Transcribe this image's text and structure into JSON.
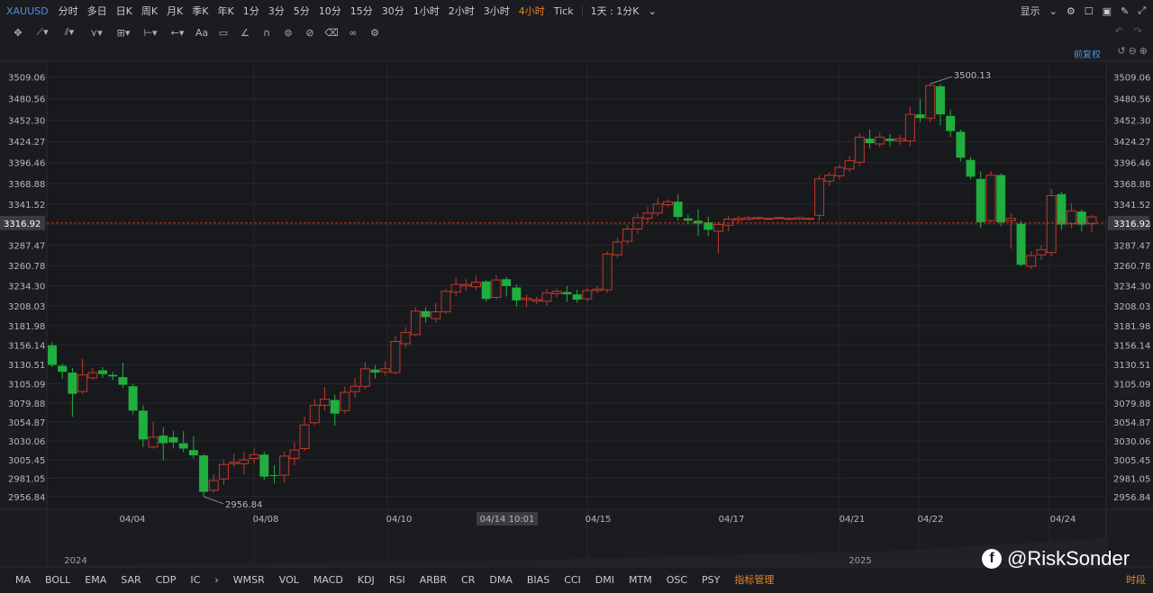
{
  "symbol": "XAUUSD",
  "timeframes": [
    "分时",
    "多日",
    "日K",
    "周K",
    "月K",
    "季K",
    "年K",
    "1分",
    "3分",
    "5分",
    "10分",
    "15分",
    "30分",
    "1小时",
    "2小时",
    "3小时",
    "4小时",
    "Tick"
  ],
  "active_timeframe": "4小时",
  "timeframe_selector": "1天 : 1分K",
  "display_label": "显示",
  "adjust_label": "前复权",
  "toolbar_icons": [
    "crosshair-icon",
    "trendline-icon",
    "fib-icon",
    "pattern-icon",
    "measure-icon",
    "ruler-icon",
    "arrow-icon",
    "text-icon",
    "note-icon",
    "brush-icon",
    "magnet-icon",
    "lock-icon",
    "hide-icon",
    "trash-icon",
    "link-icon",
    "settings-icon"
  ],
  "toolbar_text_label": "Aa",
  "indicators": [
    "MA",
    "BOLL",
    "EMA",
    "SAR",
    "CDP",
    "IC"
  ],
  "indicators2": [
    "WMSR",
    "VOL",
    "MACD",
    "KDJ",
    "RSI",
    "ARBR",
    "CR",
    "DMA",
    "BIAS",
    "CCI",
    "DMI",
    "MTM",
    "OSC",
    "PSY"
  ],
  "indicator_manage": "指标管理",
  "segment_label": "时段",
  "watermark": "@RiskSonder",
  "colors": {
    "background": "#1b1c1f",
    "up": "#c0392b",
    "down": "#1fae3f",
    "grid": "#26282c",
    "accent": "#e8832a",
    "link": "#4f8fe8"
  },
  "chart_data": {
    "type": "candlestick",
    "y_ticks": [
      3509.06,
      3480.56,
      3452.3,
      3424.27,
      3396.46,
      3368.88,
      3341.52,
      3314.6,
      3287.47,
      3260.78,
      3234.3,
      3208.03,
      3181.98,
      3156.14,
      3130.51,
      3105.09,
      3079.88,
      3054.87,
      3030.06,
      3005.45,
      2981.05,
      2956.84
    ],
    "ylim": [
      2940,
      3530
    ],
    "x_labels": [
      "04/04",
      "04/08",
      "04/10",
      "04/14 10:01",
      "04/15",
      "04/17",
      "04/21",
      "04/22",
      "04/24"
    ],
    "year_labels": [
      "2024",
      "2025"
    ],
    "current_price": "3316.92",
    "current_price_value": 3316.92,
    "high_label": "3500.13",
    "high_value": 3500.13,
    "low_label": "2956.84",
    "low_value": 2956.84,
    "candles": [
      [
        3156,
        3130,
        3160,
        3127
      ],
      [
        3129,
        3121,
        3132,
        3112
      ],
      [
        3120,
        3092,
        3126,
        3062
      ],
      [
        3095,
        3117,
        3138,
        3092
      ],
      [
        3113,
        3120,
        3126,
        3111
      ],
      [
        3123,
        3118,
        3127,
        3113
      ],
      [
        3117,
        3115,
        3121,
        3110
      ],
      [
        3114,
        3104,
        3133,
        3100
      ],
      [
        3102,
        3070,
        3105,
        3065
      ],
      [
        3070,
        3032,
        3077,
        3022
      ],
      [
        3022,
        3035,
        3055,
        3020
      ],
      [
        3037,
        3027,
        3048,
        3004
      ],
      [
        3035,
        3028,
        3043,
        3020
      ],
      [
        3027,
        3020,
        3043,
        3015
      ],
      [
        3018,
        3011,
        3036,
        3007
      ],
      [
        3011,
        2963,
        3013,
        2957
      ],
      [
        2965,
        2978,
        2986,
        2962
      ],
      [
        2980,
        2999,
        3005,
        2972
      ],
      [
        3000,
        3002,
        3013,
        2996
      ],
      [
        3000,
        3005,
        3016,
        2986
      ],
      [
        3007,
        3012,
        3020,
        3000
      ],
      [
        3012,
        2983,
        3016,
        2979
      ],
      [
        2985,
        2984,
        2998,
        2974
      ],
      [
        2985,
        3010,
        3016,
        2975
      ],
      [
        3007,
        3018,
        3028,
        2998
      ],
      [
        3020,
        3051,
        3062,
        3017
      ],
      [
        3054,
        3077,
        3085,
        3051
      ],
      [
        3077,
        3085,
        3101,
        3070
      ],
      [
        3084,
        3066,
        3091,
        3050
      ],
      [
        3070,
        3094,
        3102,
        3066
      ],
      [
        3095,
        3102,
        3113,
        3087
      ],
      [
        3102,
        3125,
        3134,
        3098
      ],
      [
        3124,
        3120,
        3130,
        3112
      ],
      [
        3121,
        3125,
        3135,
        3116
      ],
      [
        3120,
        3161,
        3168,
        3118
      ],
      [
        3158,
        3173,
        3180,
        3153
      ],
      [
        3170,
        3201,
        3206,
        3168
      ],
      [
        3201,
        3193,
        3206,
        3186
      ],
      [
        3191,
        3200,
        3212,
        3186
      ],
      [
        3200,
        3227,
        3230,
        3197
      ],
      [
        3226,
        3236,
        3245,
        3221
      ],
      [
        3234,
        3236,
        3243,
        3228
      ],
      [
        3233,
        3239,
        3248,
        3229
      ],
      [
        3240,
        3217,
        3242,
        3213
      ],
      [
        3219,
        3242,
        3248,
        3216
      ],
      [
        3243,
        3234,
        3246,
        3220
      ],
      [
        3232,
        3215,
        3236,
        3207
      ],
      [
        3216,
        3218,
        3223,
        3206
      ],
      [
        3214,
        3216,
        3220,
        3210
      ],
      [
        3214,
        3225,
        3230,
        3208
      ],
      [
        3224,
        3227,
        3231,
        3219
      ],
      [
        3226,
        3223,
        3234,
        3213
      ],
      [
        3223,
        3216,
        3229,
        3212
      ],
      [
        3217,
        3228,
        3231,
        3213
      ],
      [
        3228,
        3230,
        3234,
        3225
      ],
      [
        3229,
        3276,
        3280,
        3225
      ],
      [
        3275,
        3292,
        3297,
        3271
      ],
      [
        3293,
        3309,
        3314,
        3289
      ],
      [
        3309,
        3324,
        3330,
        3303
      ],
      [
        3323,
        3330,
        3338,
        3318
      ],
      [
        3330,
        3342,
        3350,
        3326
      ],
      [
        3341,
        3345,
        3348,
        3338
      ],
      [
        3345,
        3325,
        3355,
        3320
      ],
      [
        3323,
        3320,
        3328,
        3315
      ],
      [
        3320,
        3316,
        3335,
        3300
      ],
      [
        3318,
        3308,
        3325,
        3300
      ],
      [
        3306,
        3315,
        3318,
        3277
      ],
      [
        3314,
        3322,
        3326,
        3306
      ],
      [
        3321,
        3323,
        3327,
        3317
      ],
      [
        3322,
        3324,
        3326,
        3320
      ],
      [
        3323,
        3324,
        3325,
        3321
      ],
      [
        3323,
        3323,
        3324,
        3322
      ],
      [
        3323,
        3324,
        3325,
        3322
      ],
      [
        3323,
        3323,
        3324,
        3322
      ],
      [
        3322,
        3324,
        3325,
        3321
      ],
      [
        3323,
        3323,
        3324,
        3322
      ],
      [
        3327,
        3375,
        3380,
        3320
      ],
      [
        3372,
        3380,
        3384,
        3366
      ],
      [
        3379,
        3390,
        3394,
        3374
      ],
      [
        3388,
        3399,
        3405,
        3384
      ],
      [
        3397,
        3430,
        3435,
        3392
      ],
      [
        3428,
        3422,
        3440,
        3415
      ],
      [
        3421,
        3430,
        3436,
        3417
      ],
      [
        3428,
        3425,
        3434,
        3418
      ],
      [
        3425,
        3428,
        3433,
        3420
      ],
      [
        3425,
        3460,
        3470,
        3418
      ],
      [
        3460,
        3455,
        3480,
        3450
      ],
      [
        3455,
        3498,
        3500,
        3450
      ],
      [
        3497,
        3460,
        3500,
        3445
      ],
      [
        3458,
        3438,
        3466,
        3430
      ],
      [
        3437,
        3403,
        3440,
        3398
      ],
      [
        3400,
        3378,
        3404,
        3375
      ],
      [
        3375,
        3318,
        3385,
        3310
      ],
      [
        3320,
        3380,
        3385,
        3318
      ],
      [
        3380,
        3318,
        3382,
        3313
      ],
      [
        3320,
        3323,
        3330,
        3283
      ],
      [
        3316,
        3262,
        3320,
        3260
      ],
      [
        3260,
        3274,
        3280,
        3256
      ],
      [
        3275,
        3282,
        3288,
        3268
      ],
      [
        3278,
        3353,
        3362,
        3273
      ],
      [
        3355,
        3315,
        3358,
        3308
      ],
      [
        3316,
        3333,
        3343,
        3310
      ],
      [
        3332,
        3315,
        3335,
        3306
      ],
      [
        3316,
        3325,
        3328,
        3305
      ]
    ]
  }
}
